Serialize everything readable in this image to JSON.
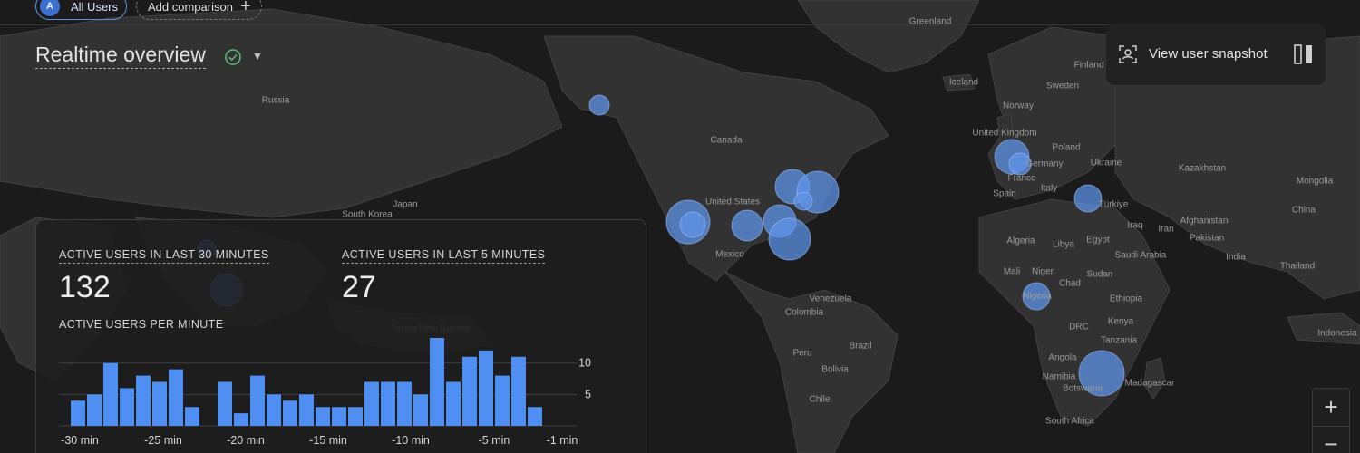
{
  "header": {
    "segment_initial": "A",
    "segment_label": "All Users",
    "add_comparison_label": "Add comparison",
    "add_icon": "plus-icon"
  },
  "page": {
    "title": "Realtime overview",
    "status_icon": "check-circle-icon",
    "status_color": "#5bb974",
    "dropdown_icon": "caret-down-icon"
  },
  "snapshot": {
    "label": "View user snapshot",
    "icon": "user-scan-icon",
    "split_icon": "split-view-icon"
  },
  "map": {
    "labels": [
      "Greenland",
      "Iceland",
      "Finland",
      "Sweden",
      "Norway",
      "United Kingdom",
      "Poland",
      "Ukraine",
      "Germany",
      "France",
      "Spain",
      "Italy",
      "Türkiye",
      "Kazakhstan",
      "Mongolia",
      "China",
      "Russia",
      "Japan",
      "South Korea",
      "Canada",
      "United States",
      "Mexico",
      "Venezuela",
      "Colombia",
      "Peru",
      "Brazil",
      "Bolivia",
      "Chile",
      "Algeria",
      "Libya",
      "Egypt",
      "Saudi Arabia",
      "Iraq",
      "Iran",
      "Afghanistan",
      "Pakistan",
      "India",
      "Thailand",
      "Indonesia",
      "Mali",
      "Niger",
      "Chad",
      "Sudan",
      "Ethiopia",
      "Nigeria",
      "DRC",
      "Kenya",
      "Tanzania",
      "Angola",
      "Namibia",
      "Botswana",
      "Madagascar",
      "South Africa",
      "Papua New Guinea"
    ],
    "bubble_color": "#6096eb"
  },
  "card": {
    "active_30_label": "ACTIVE USERS IN LAST 30 MINUTES",
    "active_30_value": "132",
    "active_5_label": "ACTIVE USERS IN LAST 5 MINUTES",
    "active_5_value": "27",
    "per_minute_label": "ACTIVE USERS PER MINUTE"
  },
  "zoom": {
    "in": "+",
    "out": "−"
  },
  "chart_data": {
    "type": "bar",
    "title": "ACTIVE USERS PER MINUTE",
    "color": "#4f8ff2",
    "values": [
      4,
      5,
      10,
      6,
      8,
      7,
      9,
      3,
      0,
      7,
      2,
      8,
      5,
      4,
      5,
      3,
      3,
      3,
      7,
      7,
      7,
      5,
      14,
      7,
      11,
      12,
      8,
      11,
      3,
      0
    ],
    "ylim": [
      0,
      14
    ],
    "yticks": [
      5,
      10
    ],
    "xtick_labels": [
      "-30 min",
      "-25 min",
      "-20 min",
      "-15 min",
      "-10 min",
      "-5 min",
      "-1 min"
    ],
    "grid": true
  }
}
